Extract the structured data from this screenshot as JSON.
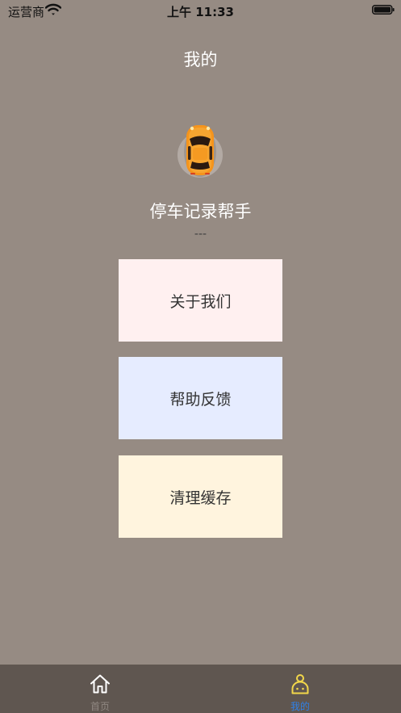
{
  "status_bar": {
    "carrier": "运营商",
    "time": "上午 11:33"
  },
  "header": {
    "title": "我的"
  },
  "profile": {
    "app_name": "停车记录帮手",
    "version": "---",
    "avatar_icon": "car-icon"
  },
  "menu": {
    "items": [
      {
        "label": "关于我们",
        "color": "#fff0f0"
      },
      {
        "label": "帮助反馈",
        "color": "#e6ecff"
      },
      {
        "label": "清理缓存",
        "color": "#fff4de"
      }
    ]
  },
  "tab_bar": {
    "tabs": [
      {
        "label": "首页",
        "icon": "home-icon",
        "active": false
      },
      {
        "label": "我的",
        "icon": "user-icon",
        "active": true
      }
    ],
    "active_color": "#2f80e6",
    "active_icon_color": "#f2d74a"
  }
}
